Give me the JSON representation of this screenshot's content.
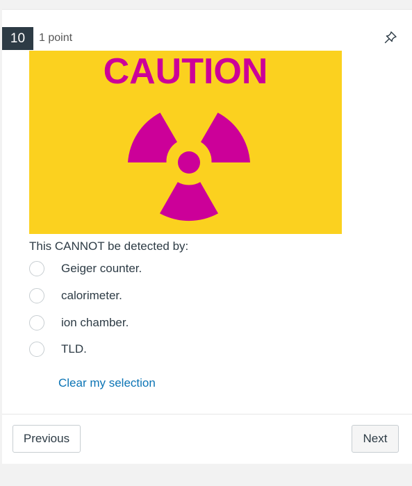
{
  "question": {
    "number": "10",
    "points": "1 point",
    "image": {
      "caption_text": "CAUTION",
      "background_color": "#fbd11f",
      "text_color": "#cc0099",
      "symbol": "radiation-trefoil"
    },
    "prompt": "This CANNOT be detected by:",
    "options": [
      {
        "label": "Geiger counter."
      },
      {
        "label": "calorimeter."
      },
      {
        "label": "ion chamber."
      },
      {
        "label": "TLD."
      }
    ],
    "clear_label": "Clear my selection"
  },
  "nav": {
    "previous_label": "Previous",
    "next_label": "Next"
  },
  "icons": {
    "pin": "pin-icon"
  },
  "colors": {
    "question_number_bg": "#2d3b45",
    "link": "#0b74b5"
  }
}
